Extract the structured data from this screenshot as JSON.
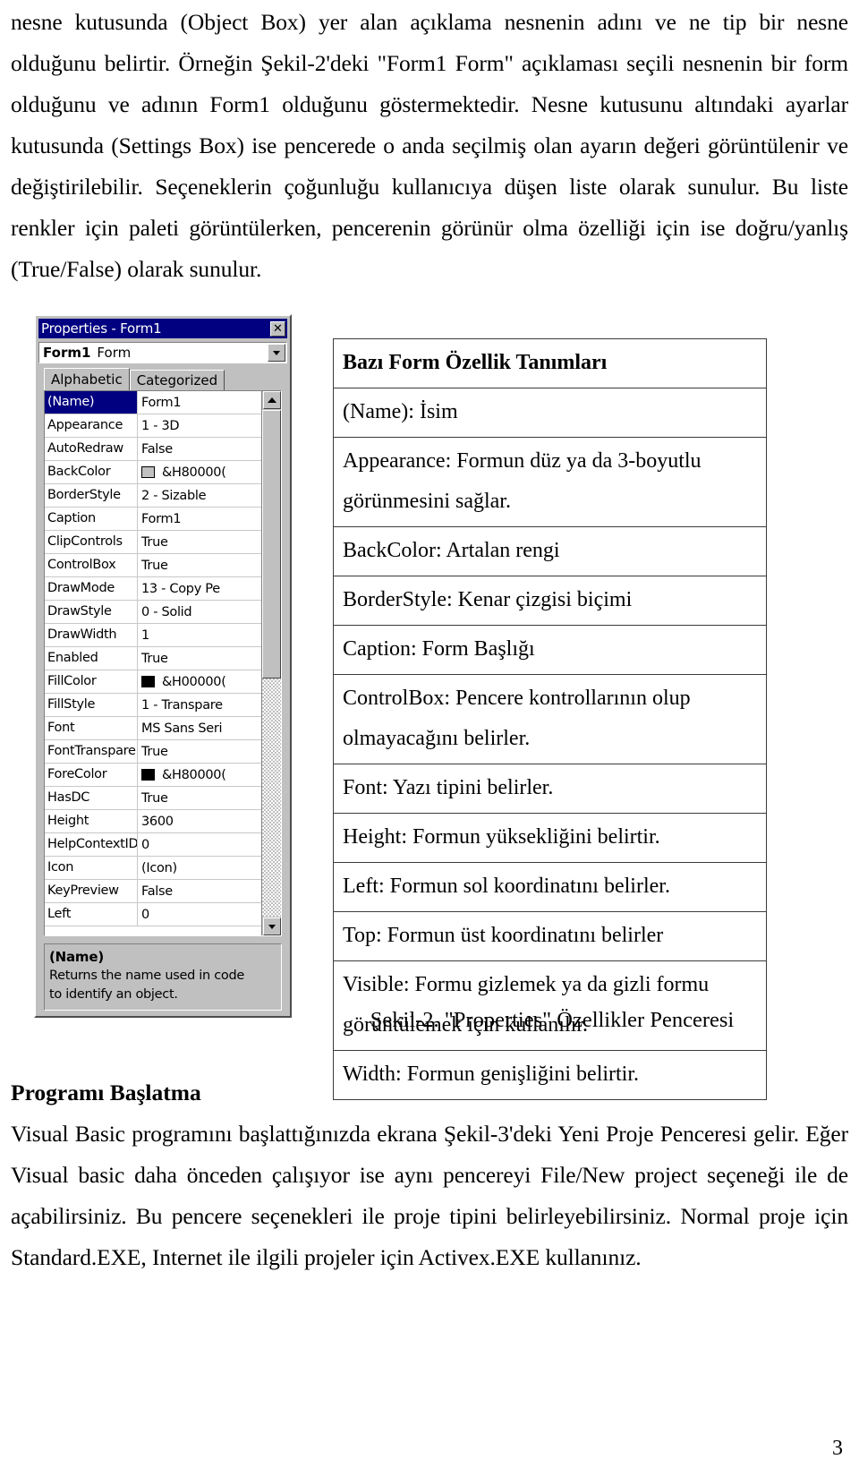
{
  "page": {
    "number": "3"
  },
  "top_text": {
    "paragraph": "nesne kutusunda (Object Box) yer alan açıklama nesnenin adını ve ne tip bir nesne olduğunu belirtir. Örneğin Şekil-2'deki \"Form1 Form\" açıklaması seçili nesnenin bir form olduğunu ve adının Form1 olduğunu göstermektedir. Nesne kutusunu altındaki ayarlar kutusunda (Settings Box) ise pencerede o anda seçilmiş olan ayarın değeri görüntülenir ve değiştirilebilir. Seçeneklerin çoğunluğu kullanıcıya düşen liste olarak sunulur. Bu liste renkler için paleti görüntülerken, pencerenin görünür olma özelliği için ise doğru/yanlış (True/False) olarak sunulur."
  },
  "properties_window": {
    "title": "Properties - Form1",
    "close_label": "✕",
    "object_box": {
      "name": "Form1",
      "type": "Form",
      "dropdown_icon": "chevron-down-icon"
    },
    "tabs": [
      {
        "label": "Alphabetic",
        "active": true
      },
      {
        "label": "Categorized",
        "active": false
      }
    ],
    "rows": [
      {
        "key": "(Name)",
        "value": "Form1",
        "selected": true,
        "swatch": ""
      },
      {
        "key": "Appearance",
        "value": "1 - 3D",
        "selected": false,
        "swatch": ""
      },
      {
        "key": "AutoRedraw",
        "value": "False",
        "selected": false,
        "swatch": ""
      },
      {
        "key": "BackColor",
        "value": "&H80000(",
        "selected": false,
        "swatch": "#c0c0c0"
      },
      {
        "key": "BorderStyle",
        "value": "2 - Sizable",
        "selected": false,
        "swatch": ""
      },
      {
        "key": "Caption",
        "value": "Form1",
        "selected": false,
        "swatch": ""
      },
      {
        "key": "ClipControls",
        "value": "True",
        "selected": false,
        "swatch": ""
      },
      {
        "key": "ControlBox",
        "value": "True",
        "selected": false,
        "swatch": ""
      },
      {
        "key": "DrawMode",
        "value": "13 - Copy Pe",
        "selected": false,
        "swatch": ""
      },
      {
        "key": "DrawStyle",
        "value": "0 - Solid",
        "selected": false,
        "swatch": ""
      },
      {
        "key": "DrawWidth",
        "value": "1",
        "selected": false,
        "swatch": ""
      },
      {
        "key": "Enabled",
        "value": "True",
        "selected": false,
        "swatch": ""
      },
      {
        "key": "FillColor",
        "value": "&H00000(",
        "selected": false,
        "swatch": "#000000"
      },
      {
        "key": "FillStyle",
        "value": "1 - Transpare",
        "selected": false,
        "swatch": ""
      },
      {
        "key": "Font",
        "value": "MS Sans Seri",
        "selected": false,
        "swatch": ""
      },
      {
        "key": "FontTranspare",
        "value": "True",
        "selected": false,
        "swatch": ""
      },
      {
        "key": "ForeColor",
        "value": "&H80000(",
        "selected": false,
        "swatch": "#000000"
      },
      {
        "key": "HasDC",
        "value": "True",
        "selected": false,
        "swatch": ""
      },
      {
        "key": "Height",
        "value": "3600",
        "selected": false,
        "swatch": ""
      },
      {
        "key": "HelpContextID",
        "value": "0",
        "selected": false,
        "swatch": ""
      },
      {
        "key": "Icon",
        "value": "(Icon)",
        "selected": false,
        "swatch": ""
      },
      {
        "key": "KeyPreview",
        "value": "False",
        "selected": false,
        "swatch": ""
      },
      {
        "key": "Left",
        "value": "0",
        "selected": false,
        "swatch": ""
      }
    ],
    "scrollbar": {
      "up_icon": "triangle-up-icon",
      "down_icon": "triangle-down-icon"
    },
    "description": {
      "title": "(Name)",
      "line1": "Returns the name used in code",
      "line2": "to identify an object."
    }
  },
  "definitions_table": {
    "header": "Bazı Form Özellik Tanımları",
    "rows": [
      "(Name):  İsim",
      "Appearance: Formun düz ya da 3-boyutlu görünmesini sağlar.",
      "BackColor: Artalan rengi",
      "BorderStyle: Kenar çizgisi biçimi",
      "Caption: Form Başlığı",
      "ControlBox: Pencere kontrollarının olup olmayacağını belirler.",
      "Font: Yazı tipini belirler.",
      "Height: Formun yüksekliğini belirtir.",
      "Left: Formun sol koordinatını belirler.",
      "Top: Formun üst koordinatını belirler",
      "Visible: Formu gizlemek ya da gizli formu görüntülemek için kullanılır.",
      "Width: Formun genişliğini belirtir."
    ]
  },
  "figure_caption": "Şekil-2. \"Properties\" Özellikler Penceresi",
  "bottom_text": {
    "heading": "Programı Başlatma",
    "paragraph": "Visual Basic programını başlattığınızda ekrana Şekil-3'deki Yeni Proje Penceresi gelir. Eğer Visual basic daha önceden çalışıyor ise aynı pencereyi File/New project seçeneği ile de açabilirsiniz. Bu pencere seçenekleri ile proje tipini belirleyebilirsiniz. Normal proje için Standard.EXE, Internet ile ilgili projeler için Activex.EXE kullanınız."
  }
}
